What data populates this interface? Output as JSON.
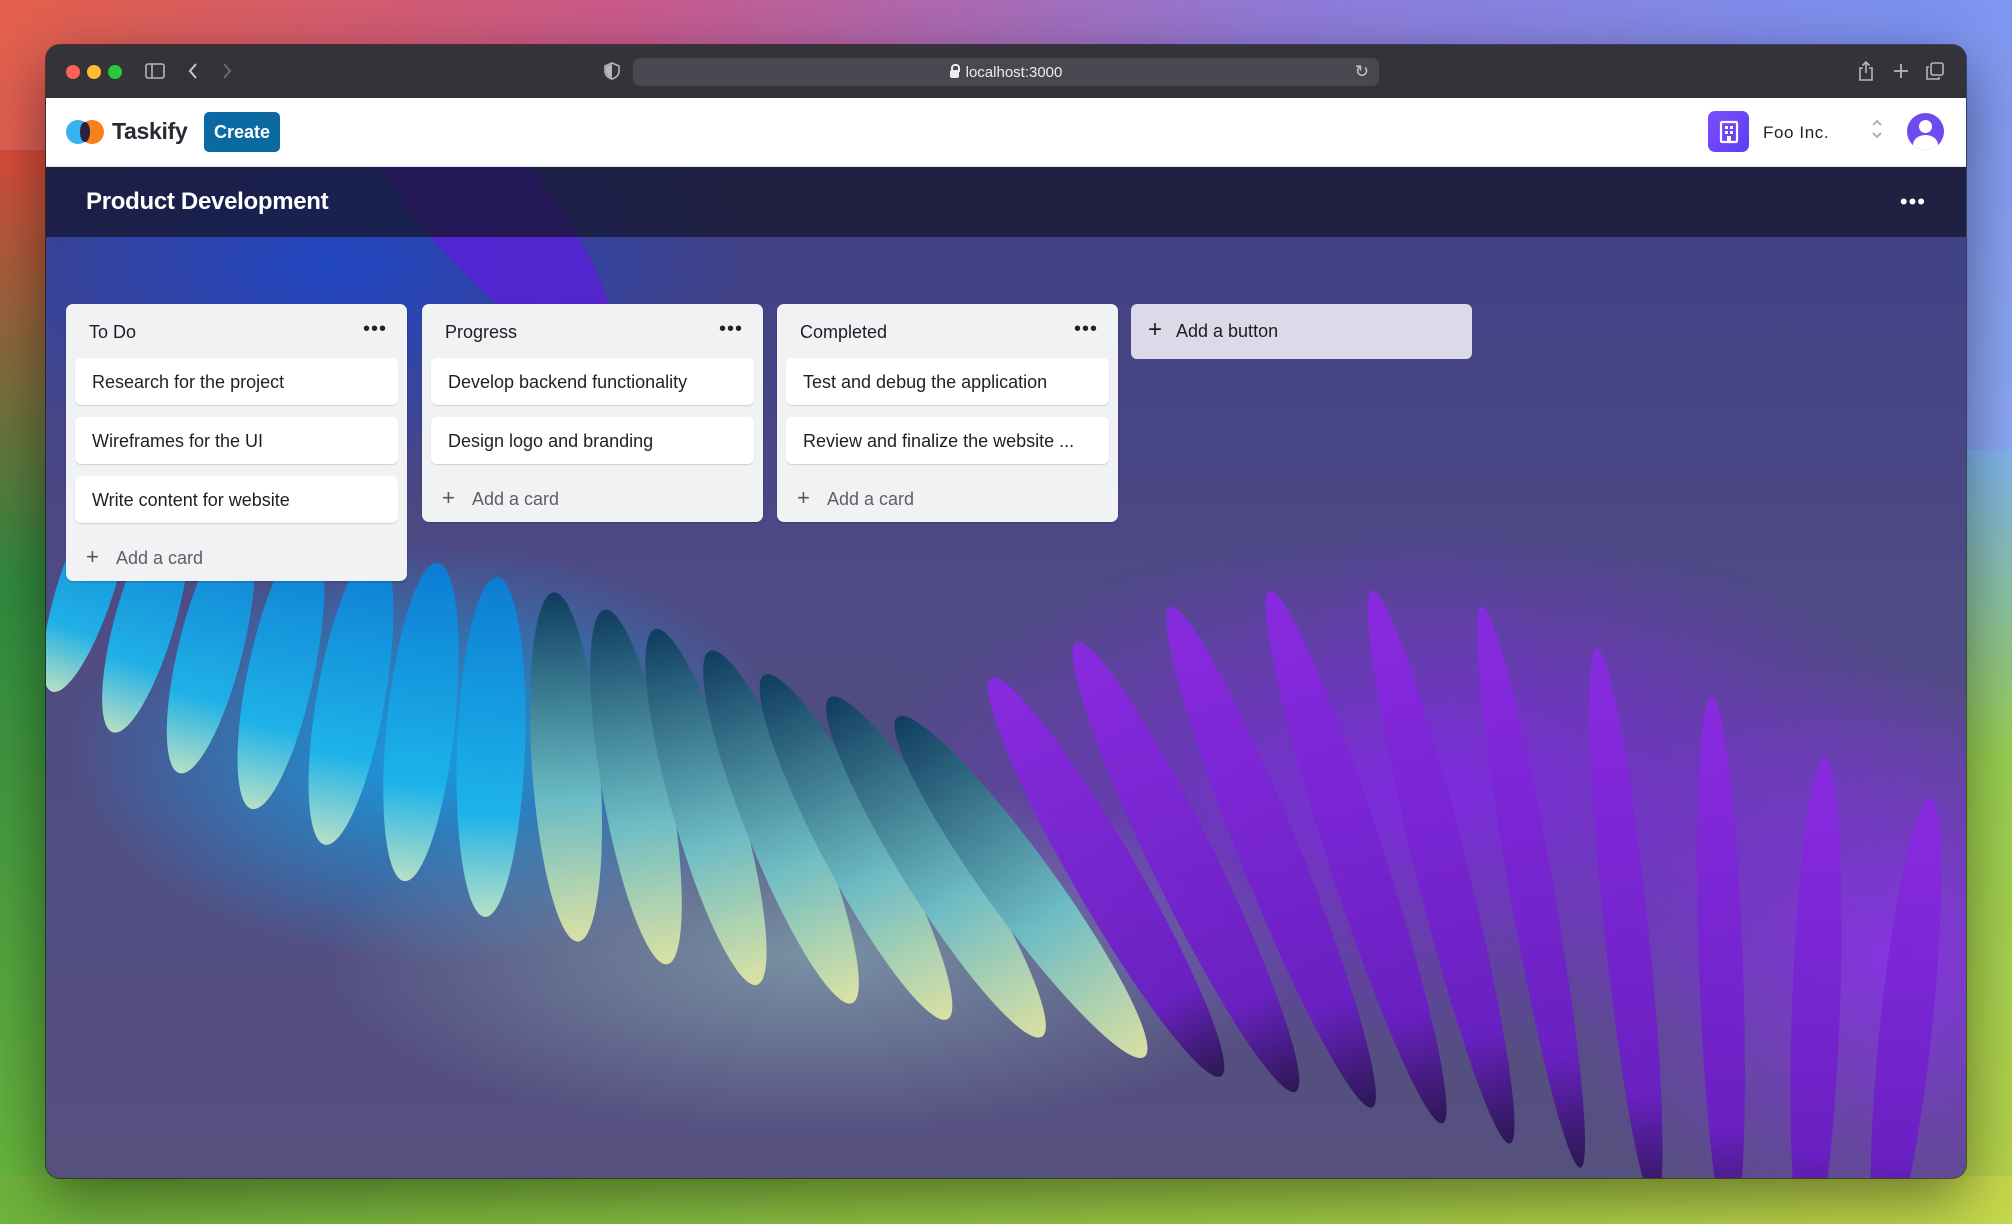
{
  "browser": {
    "url": "localhost:3000"
  },
  "nav": {
    "brand": "Taskify",
    "create_label": "Create",
    "org_name": "Foo Inc."
  },
  "board": {
    "title": "Product Development",
    "add_list_label": "Add a button",
    "lists": [
      {
        "title": "To Do",
        "cards": [
          "Research for the project",
          "Wireframes for the UI",
          "Write content for website"
        ],
        "add_card_label": "Add a card"
      },
      {
        "title": "Progress",
        "cards": [
          "Develop backend functionality",
          "Design logo and branding"
        ],
        "add_card_label": "Add a card"
      },
      {
        "title": "Completed",
        "cards": [
          "Test and debug the application",
          "Review and finalize the website ..."
        ],
        "add_card_label": "Add a card"
      }
    ]
  },
  "colors": {
    "create_button": "#0a6aa1",
    "org_icon": "#6b46f5",
    "avatar": "#6f4bef"
  },
  "icons": {
    "window_controls": [
      "close-dot",
      "minimize-dot",
      "zoom-dot"
    ],
    "toolbar": [
      "sidebar-icon",
      "back-icon",
      "forward-icon",
      "shield-icon",
      "lock-icon",
      "reload-icon",
      "share-icon",
      "new-tab-icon",
      "tabs-overview-icon"
    ]
  }
}
